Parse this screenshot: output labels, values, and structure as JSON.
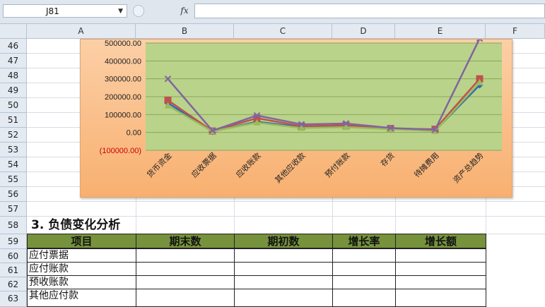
{
  "formula_bar": {
    "cell_ref": "J81",
    "fx_label": "fx",
    "formula": ""
  },
  "columns": [
    "A",
    "B",
    "C",
    "D",
    "E",
    "F"
  ],
  "rows": [
    "46",
    "47",
    "48",
    "49",
    "50",
    "51",
    "52",
    "53",
    "54",
    "55",
    "56",
    "57",
    "58",
    "59",
    "60",
    "61",
    "62",
    "63"
  ],
  "chart_data": {
    "type": "line",
    "categories": [
      "货币资金",
      "应收票据",
      "应收账款",
      "其他应收款",
      "预付账款",
      "存货",
      "待摊费用",
      "资产总趋势"
    ],
    "yticks": [
      "500000.00",
      "400000.00",
      "300000.00",
      "200000.00",
      "100000.00",
      "0.00",
      "(100000.00)"
    ],
    "ylim": [
      -100000,
      500000
    ],
    "grid": true,
    "plot_color": "#b9d38a",
    "series": [
      {
        "color": "#2a6db5",
        "marker": "diamond",
        "values": [
          165000,
          5000,
          60000,
          30000,
          35000,
          20000,
          10000,
          265000
        ]
      },
      {
        "color": "#c0504d",
        "marker": "square",
        "values": [
          180000,
          8000,
          80000,
          35000,
          40000,
          22000,
          18000,
          300000
        ]
      },
      {
        "color": "#9bbb59",
        "marker": "triangle",
        "values": [
          150000,
          6000,
          55000,
          25000,
          30000,
          18000,
          8000,
          280000
        ]
      },
      {
        "color": "#8064a2",
        "marker": "x",
        "values": [
          300000,
          10000,
          95000,
          45000,
          50000,
          25000,
          15000,
          525000
        ]
      }
    ]
  },
  "section_title": "3. 负债变化分析",
  "table": {
    "headers": [
      "项目",
      "期末数",
      "期初数",
      "增长率",
      "增长额"
    ],
    "rows": [
      [
        "应付票据",
        "",
        "",
        "",
        ""
      ],
      [
        "应付账款",
        "",
        "",
        "",
        ""
      ],
      [
        "预收账款",
        "",
        "",
        "",
        ""
      ],
      [
        "其他应付款",
        "",
        "",
        "",
        ""
      ]
    ]
  }
}
